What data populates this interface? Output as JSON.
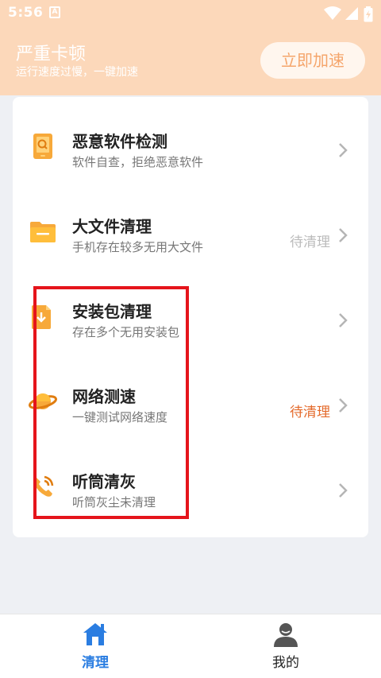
{
  "status_bar": {
    "time": "5:56",
    "notif_glyph": "A"
  },
  "header": {
    "title": "严重卡顿",
    "subtitle": "运行速度过慢，一键加速",
    "boost_button": "立即加速"
  },
  "items": [
    {
      "title": "恶意软件检测",
      "desc": "软件自查，拒绝恶意软件",
      "status": "",
      "icon": "phone-search-icon"
    },
    {
      "title": "大文件清理",
      "desc": "手机存在较多无用大文件",
      "status": "待清理",
      "status_color": "#bbbbbb",
      "icon": "folder-icon"
    },
    {
      "title": "安装包清理",
      "desc": "存在多个无用安装包",
      "status": "",
      "icon": "package-download-icon"
    },
    {
      "title": "网络测速",
      "desc": "一键测试网络速度",
      "status": "待清理",
      "status_color": "#e46a2b",
      "icon": "planet-icon"
    },
    {
      "title": "听筒清灰",
      "desc": "听筒灰尘未清理",
      "status": "",
      "icon": "phone-ring-icon"
    }
  ],
  "tabs": [
    {
      "label": "清理",
      "icon": "home-icon",
      "active": true
    },
    {
      "label": "我的",
      "icon": "user-icon",
      "active": false
    }
  ],
  "colors": {
    "accent_orange": "#f7a93a",
    "tab_active": "#2a7de1",
    "header_bg": "#fcd8ba",
    "highlight": "#e5141b"
  }
}
